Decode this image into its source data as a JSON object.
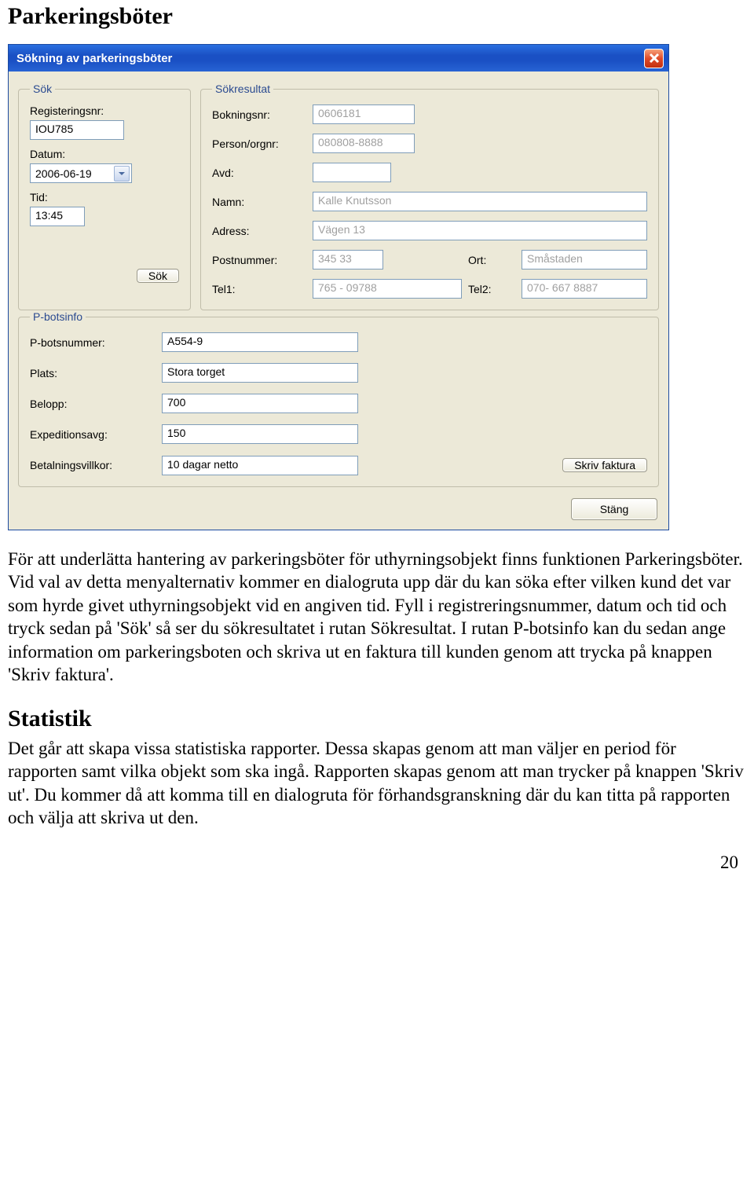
{
  "heading_main": "Parkeringsböter",
  "dialog": {
    "title": "Sökning av parkeringsböter",
    "group_sok": {
      "legend": "Sök",
      "reg_label": "Registeringsnr:",
      "reg_value": "IOU785",
      "date_label": "Datum:",
      "date_value": "2006-06-19",
      "time_label": "Tid:",
      "time_value": "13:45",
      "search_btn": "Sök"
    },
    "group_res": {
      "legend": "Sökresultat",
      "bokning_label": "Bokningsnr:",
      "bokning_value": "0606181",
      "person_label": "Person/orgnr:",
      "person_value": "080808-8888",
      "avd_label": "Avd:",
      "avd_value": "",
      "namn_label": "Namn:",
      "namn_value": "Kalle Knutsson",
      "adress_label": "Adress:",
      "adress_value": "Vägen 13",
      "postnr_label": "Postnummer:",
      "postnr_value": "345 33",
      "ort_label": "Ort:",
      "ort_value": "Småstaden",
      "tel1_label": "Tel1:",
      "tel1_value": "765 - 09788",
      "tel2_label": "Tel2:",
      "tel2_value": "070- 667 8887"
    },
    "group_pbot": {
      "legend": "P-botsinfo",
      "pnr_label": "P-botsnummer:",
      "pnr_value": "A554-9",
      "plats_label": "Plats:",
      "plats_value": "Stora torget",
      "belopp_label": "Belopp:",
      "belopp_value": "700",
      "exp_label": "Expeditionsavg:",
      "exp_value": "150",
      "vill_label": "Betalningsvillkor:",
      "vill_value": "10 dagar netto",
      "faktura_btn": "Skriv faktura"
    },
    "close_btn": "Stäng"
  },
  "para1": "För att underlätta hantering av parkeringsböter för uthyrningsobjekt finns funktionen Parkeringsböter. Vid val av detta menyalternativ kommer en dialogruta upp där du kan söka efter vilken kund det var som hyrde givet uthyrningsobjekt vid en angiven tid. Fyll i registreringsnummer, datum och tid och tryck sedan på 'Sök' så ser du sökresultatet i rutan Sökresultat. I rutan P-botsinfo kan du sedan ange information om parkeringsboten och skriva ut en faktura till kunden genom att trycka på knappen 'Skriv faktura'.",
  "heading_stats": "Statistik",
  "para2": "Det går att skapa vissa statistiska rapporter. Dessa skapas genom att man väljer en period för rapporten samt vilka objekt som ska ingå. Rapporten skapas genom att man trycker på knappen 'Skriv ut'. Du kommer då att komma till en dialogruta för förhandsgranskning där du kan titta på rapporten och välja att skriva ut den.",
  "page_number": "20"
}
